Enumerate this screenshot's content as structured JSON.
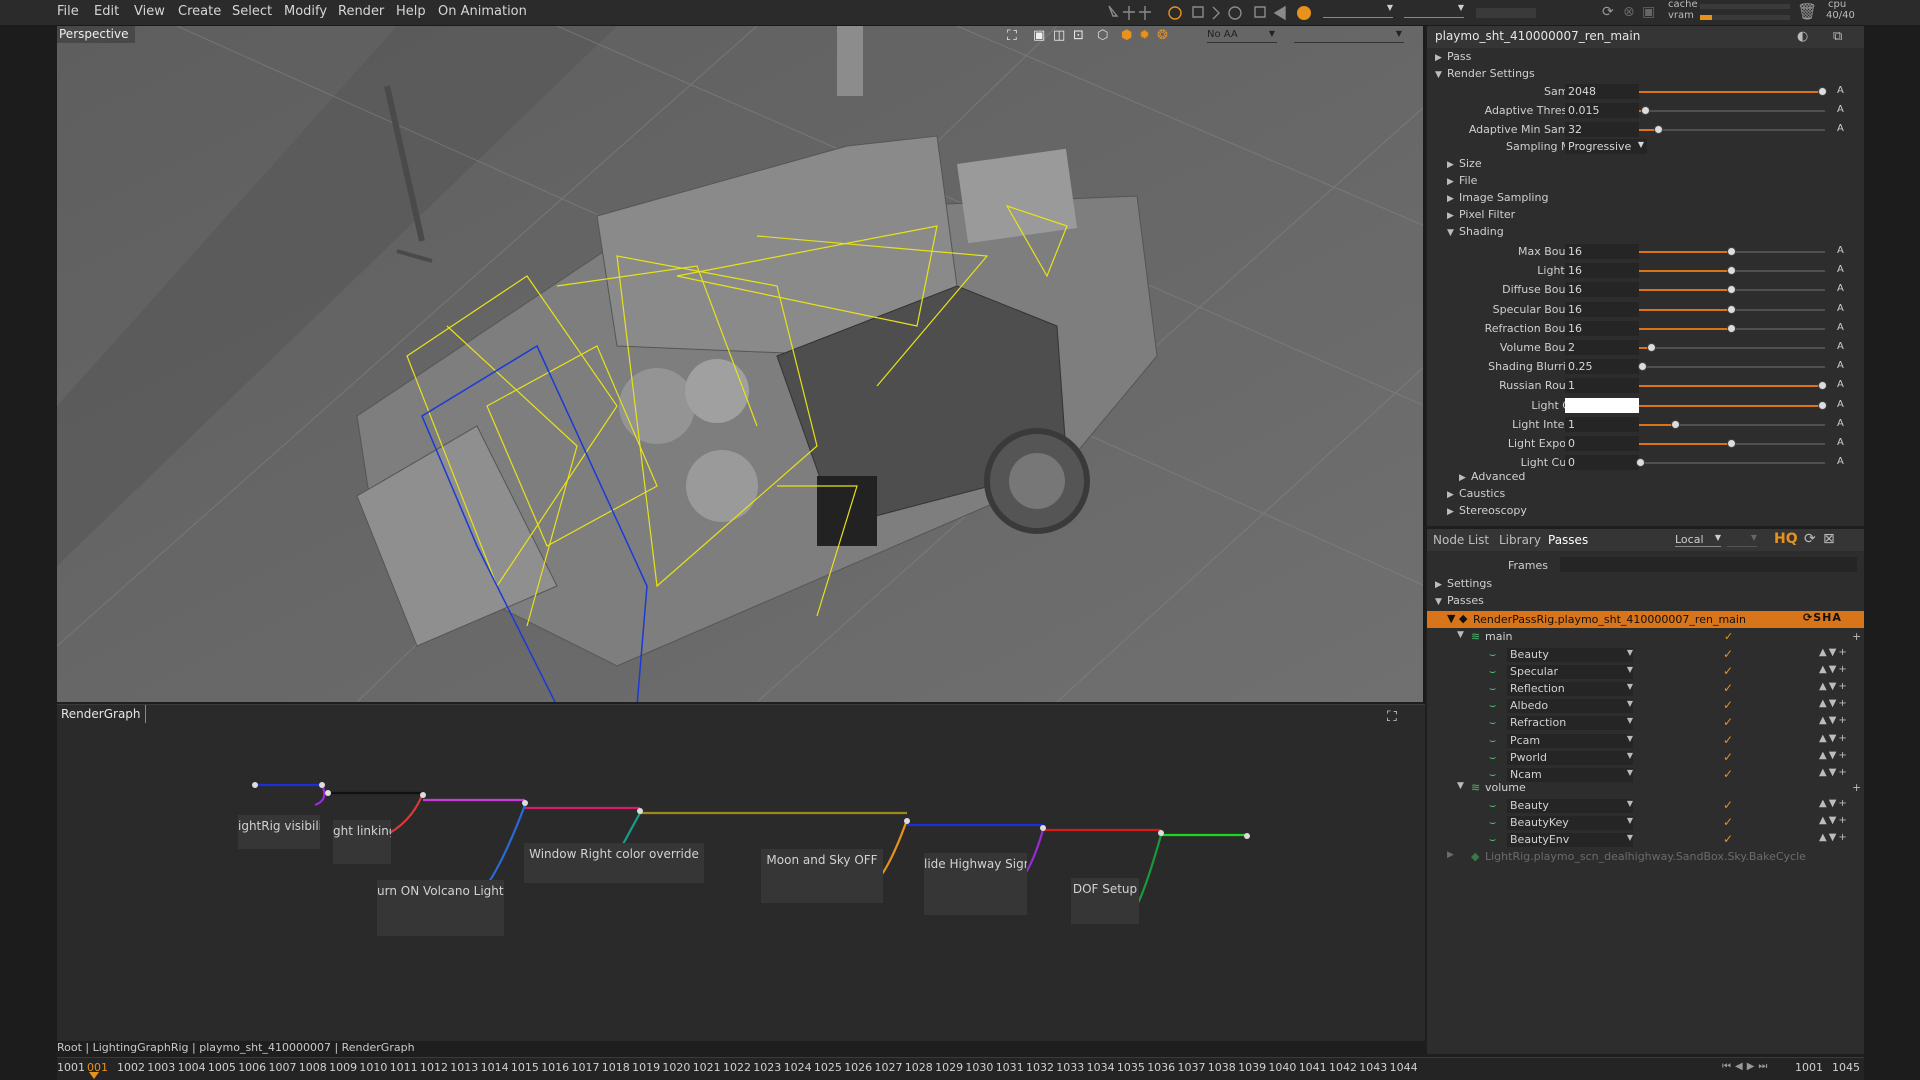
{
  "menu": [
    "File",
    "Edit",
    "View",
    "Create",
    "Select",
    "Modify",
    "Render",
    "Help",
    "On Animation"
  ],
  "menu_right": {
    "cache_label": "cache",
    "vram_label": "vram",
    "cpu_label": "cpu",
    "cpu_value": "40/40"
  },
  "viewport": {
    "label": "Perspective",
    "aa_label": "No AA"
  },
  "properties": {
    "title": "playmo_sht_410000007_ren_main",
    "sections_top": [
      "Pass",
      "Render Settings"
    ],
    "render_rows": [
      {
        "label": "Samples",
        "value": "2048",
        "pos": 0.99
      },
      {
        "label": "Adaptive Threshold",
        "value": "0.015",
        "pos": 0.04
      },
      {
        "label": "Adaptive Min Samples",
        "value": "32",
        "pos": 0.11
      }
    ],
    "sampling_mode": {
      "label": "Sampling Mode",
      "value": "Progressive"
    },
    "collapsed": [
      "Size",
      "File",
      "Image Sampling",
      "Pixel Filter"
    ],
    "shading_label": "Shading",
    "shading_rows": [
      {
        "label": "Max Bounces",
        "value": "16",
        "pos": 0.5
      },
      {
        "label": "Light Max",
        "value": "16",
        "pos": 0.5
      },
      {
        "label": "Diffuse Bounces",
        "value": "16",
        "pos": 0.5
      },
      {
        "label": "Specular Bounces",
        "value": "16",
        "pos": 0.5
      },
      {
        "label": "Refraction Bounces",
        "value": "16",
        "pos": 0.5
      },
      {
        "label": "Volume Bounces",
        "value": "2",
        "pos": 0.07
      },
      {
        "label": "Shading Blurriness",
        "value": "0.25",
        "pos": 0.02
      },
      {
        "label": "Russian Roulette",
        "value": "1",
        "pos": 0.99
      },
      {
        "label": "Light Color",
        "value": "",
        "pos": 0.99,
        "swatch": true
      },
      {
        "label": "Light Intensity",
        "value": "1",
        "pos": 0.2
      },
      {
        "label": "Light Exponent",
        "value": "0",
        "pos": 0.5
      },
      {
        "label": "Light Cut-Off",
        "value": "0",
        "pos": 0.01
      }
    ],
    "advanced": "Advanced",
    "tail": [
      "Caustics",
      "Stereoscopy"
    ],
    "a_label": "A"
  },
  "passes": {
    "tabs": [
      "Node List",
      "Library",
      "Passes"
    ],
    "local": "Local",
    "frames_label": "Frames",
    "hq": "HQ",
    "settings": "Settings",
    "passes_label": "Passes",
    "rig": "RenderPassRig.playmo_sht_410000007_ren_main",
    "main": "main",
    "main_aovs": [
      "Beauty",
      "Specular",
      "Reflection",
      "Albedo",
      "Refraction",
      "Pcam",
      "Pworld",
      "Ncam"
    ],
    "volume": "volume",
    "volume_aovs": [
      "Beauty",
      "BeautyKey",
      "BeautyEnv"
    ],
    "lightrig": "LightRig.playmo_scn_dealhighway.SandBox.Sky.BakeCycle"
  },
  "rendergraph": {
    "tab": "RenderGraph",
    "nodes": [
      "ightRig visibilit",
      "ght linking",
      "urn ON Volcano Lightri",
      "Window Right color override",
      "Moon and Sky OFF",
      "lide Highway Sign",
      "DOF Setup"
    ]
  },
  "breadcrumb": "Root | LightingGraphRig | playmo_sht_410000007 | RenderGraph",
  "timeline": {
    "start_frame": "1001",
    "current": "001",
    "ticks": [
      "1002",
      "1003",
      "1004",
      "1005",
      "1006",
      "1007",
      "1008",
      "1009",
      "1010",
      "1011",
      "1012",
      "1013",
      "1014",
      "1015",
      "1016",
      "1017",
      "1018",
      "1019",
      "1020",
      "1021",
      "1022",
      "1023",
      "1024",
      "1025",
      "1026",
      "1027",
      "1028",
      "1029",
      "1030",
      "1031",
      "1032",
      "1033",
      "1034",
      "1035",
      "1036",
      "1037",
      "1038",
      "1039",
      "1040",
      "1041",
      "1042",
      "1043",
      "1044"
    ],
    "range_start": "1001",
    "range_end": "1045"
  }
}
